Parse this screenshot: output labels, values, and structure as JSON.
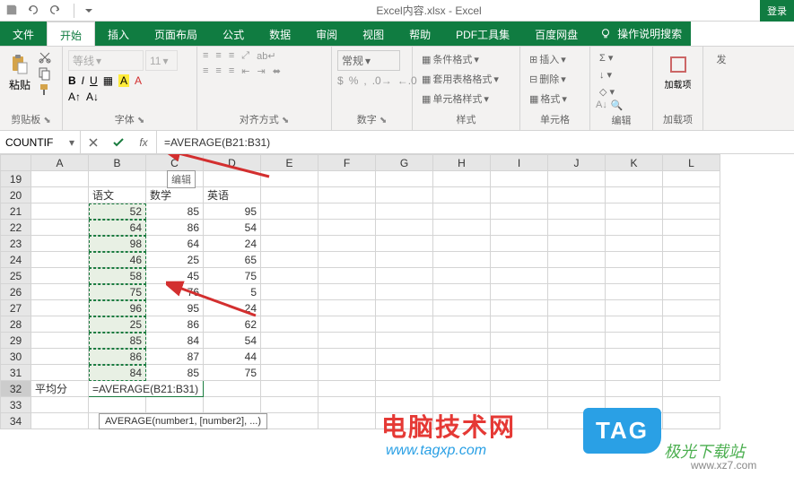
{
  "titlebar": {
    "title": "Excel内容.xlsx - Excel",
    "login": "登录"
  },
  "tabs": {
    "file": "文件",
    "home": "开始",
    "insert": "插入",
    "layout": "页面布局",
    "formulas": "公式",
    "data": "数据",
    "review": "审阅",
    "view": "视图",
    "help": "帮助",
    "pdf": "PDF工具集",
    "baidu": "百度网盘",
    "tellme": "操作说明搜索"
  },
  "ribbon": {
    "clipboard": {
      "label": "剪贴板",
      "paste": "粘贴"
    },
    "font": {
      "label": "字体",
      "family": "等线",
      "size": "11"
    },
    "alignment": {
      "label": "对齐方式"
    },
    "number": {
      "label": "数字",
      "format": "常规"
    },
    "styles": {
      "label": "样式",
      "cond": "条件格式",
      "table": "套用表格格式",
      "cell": "单元格样式"
    },
    "cells": {
      "label": "单元格",
      "insert": "插入",
      "delete": "删除",
      "format": "格式"
    },
    "editing": {
      "label": "编辑"
    },
    "addin": {
      "label": "加载项",
      "btn": "加载项"
    },
    "launch": "发"
  },
  "formula_bar": {
    "name_box": "COUNTIF",
    "formula": "=AVERAGE(B21:B31)",
    "edit_label": "编辑",
    "hint": "AVERAGE(number1, [number2], ...)"
  },
  "grid": {
    "cols": [
      "A",
      "B",
      "C",
      "D",
      "E",
      "F",
      "G",
      "H",
      "I",
      "J",
      "K",
      "L"
    ],
    "rows": [
      " ",
      "19",
      "20",
      "21",
      "22",
      "23",
      "24",
      "25",
      "26",
      "27",
      "28",
      "29",
      "30",
      "31",
      "32",
      "33",
      "34"
    ],
    "headers": {
      "b20": "语文",
      "c20": "数学",
      "d20": "英语"
    },
    "data_b": [
      52,
      64,
      98,
      46,
      58,
      75,
      96,
      25,
      85,
      86,
      84
    ],
    "data_c": [
      85,
      86,
      64,
      25,
      45,
      76,
      95,
      86,
      84,
      87,
      85
    ],
    "data_d": [
      95,
      54,
      24,
      65,
      75,
      5,
      24,
      62,
      54,
      44,
      75
    ],
    "a32": "平均分",
    "b32": "=AVERAGE(B21:B31)"
  },
  "chart_data": {
    "type": "table",
    "categories": [
      "语文",
      "数学",
      "英语"
    ],
    "rows": [
      [
        52,
        85,
        95
      ],
      [
        64,
        86,
        54
      ],
      [
        98,
        64,
        24
      ],
      [
        46,
        25,
        65
      ],
      [
        58,
        45,
        75
      ],
      [
        75,
        76,
        5
      ],
      [
        96,
        95,
        24
      ],
      [
        25,
        86,
        62
      ],
      [
        85,
        84,
        54
      ],
      [
        86,
        87,
        44
      ],
      [
        84,
        85,
        75
      ]
    ],
    "formula": "=AVERAGE(B21:B31)"
  },
  "watermarks": {
    "w1": "电脑技术网",
    "w1_sub": "www.tagxp.com",
    "tag": "TAG",
    "w2": "极光下载站",
    "w2_sub": "www.xz7.com"
  },
  "colors": {
    "brand": "#107c41",
    "selection": "#e8f0e4",
    "arrow": "#d32f2f"
  }
}
